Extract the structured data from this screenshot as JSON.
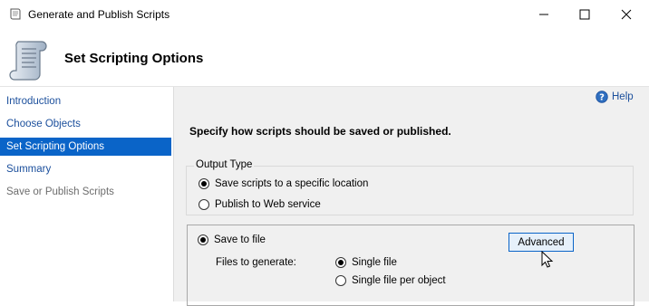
{
  "window": {
    "title": "Generate and Publish Scripts",
    "icon": "script-scroll-icon"
  },
  "header": {
    "title": "Set Scripting Options",
    "icon": "script-scroll-icon"
  },
  "sidebar": {
    "items": [
      {
        "label": "Introduction",
        "state": "link"
      },
      {
        "label": "Choose Objects",
        "state": "link"
      },
      {
        "label": "Set Scripting Options",
        "state": "selected"
      },
      {
        "label": "Summary",
        "state": "link"
      },
      {
        "label": "Save or Publish Scripts",
        "state": "disabled"
      }
    ]
  },
  "main": {
    "help_label": "Help",
    "instruction": "Specify how scripts should be saved or published.",
    "output_type": {
      "legend": "Output Type",
      "options": [
        {
          "label": "Save scripts to a specific location",
          "selected": true
        },
        {
          "label": "Publish to Web service",
          "selected": false
        }
      ]
    },
    "save_to_file": {
      "label": "Save to file",
      "selected": true,
      "advanced_label": "Advanced",
      "files_to_generate_label": "Files to generate:",
      "file_options": [
        {
          "label": "Single file",
          "selected": true
        },
        {
          "label": "Single file per object",
          "selected": false
        }
      ]
    }
  },
  "colors": {
    "selected_nav": "#0a64c8",
    "link": "#1b4f9c",
    "panel_bg": "#f0f0f0"
  }
}
